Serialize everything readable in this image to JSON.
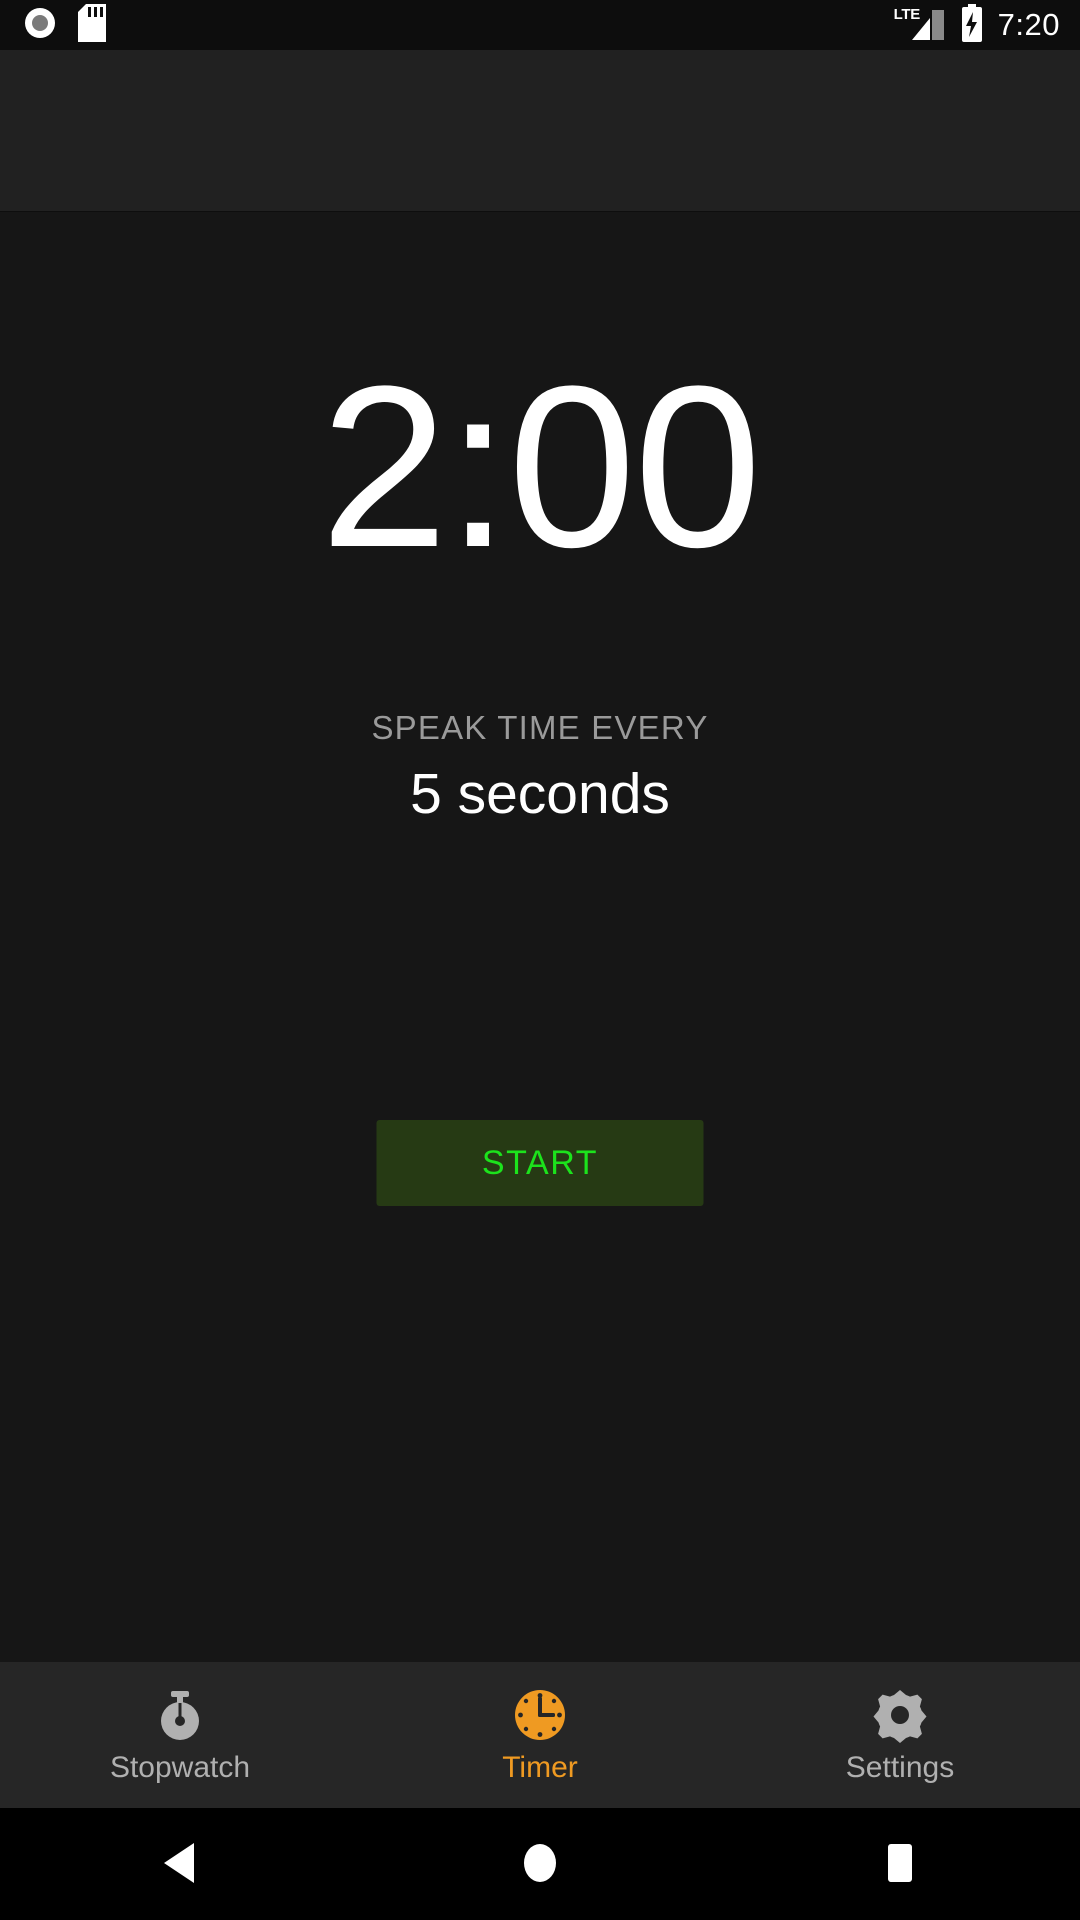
{
  "status_bar": {
    "icons_left": [
      "record-indicator-icon",
      "sd-card-icon"
    ],
    "network_label": "LTE",
    "signal_icon": "signal-bars-icon",
    "battery_icon": "battery-charging-icon",
    "clock": "7:20"
  },
  "app_bar": {
    "title": ""
  },
  "main": {
    "timer_value": "2:00",
    "speak_label": "SPEAK TIME EVERY",
    "speak_value": "5 seconds",
    "start_label": "START"
  },
  "tabs": [
    {
      "label": "Stopwatch",
      "icon": "stopwatch-icon",
      "active": false
    },
    {
      "label": "Timer",
      "icon": "clock-icon",
      "active": true
    },
    {
      "label": "Settings",
      "icon": "gear-icon",
      "active": false
    }
  ],
  "nav_bar": {
    "back": "back-triangle-icon",
    "home": "home-circle-icon",
    "recents": "recents-square-icon"
  },
  "colors": {
    "background": "#161616",
    "app_bar": "#212121",
    "tab_bar": "#262626",
    "accent_orange": "#ef9a22",
    "start_text": "#1ce31c",
    "start_bg": "#263a14",
    "muted_text": "#9a9a9a"
  }
}
